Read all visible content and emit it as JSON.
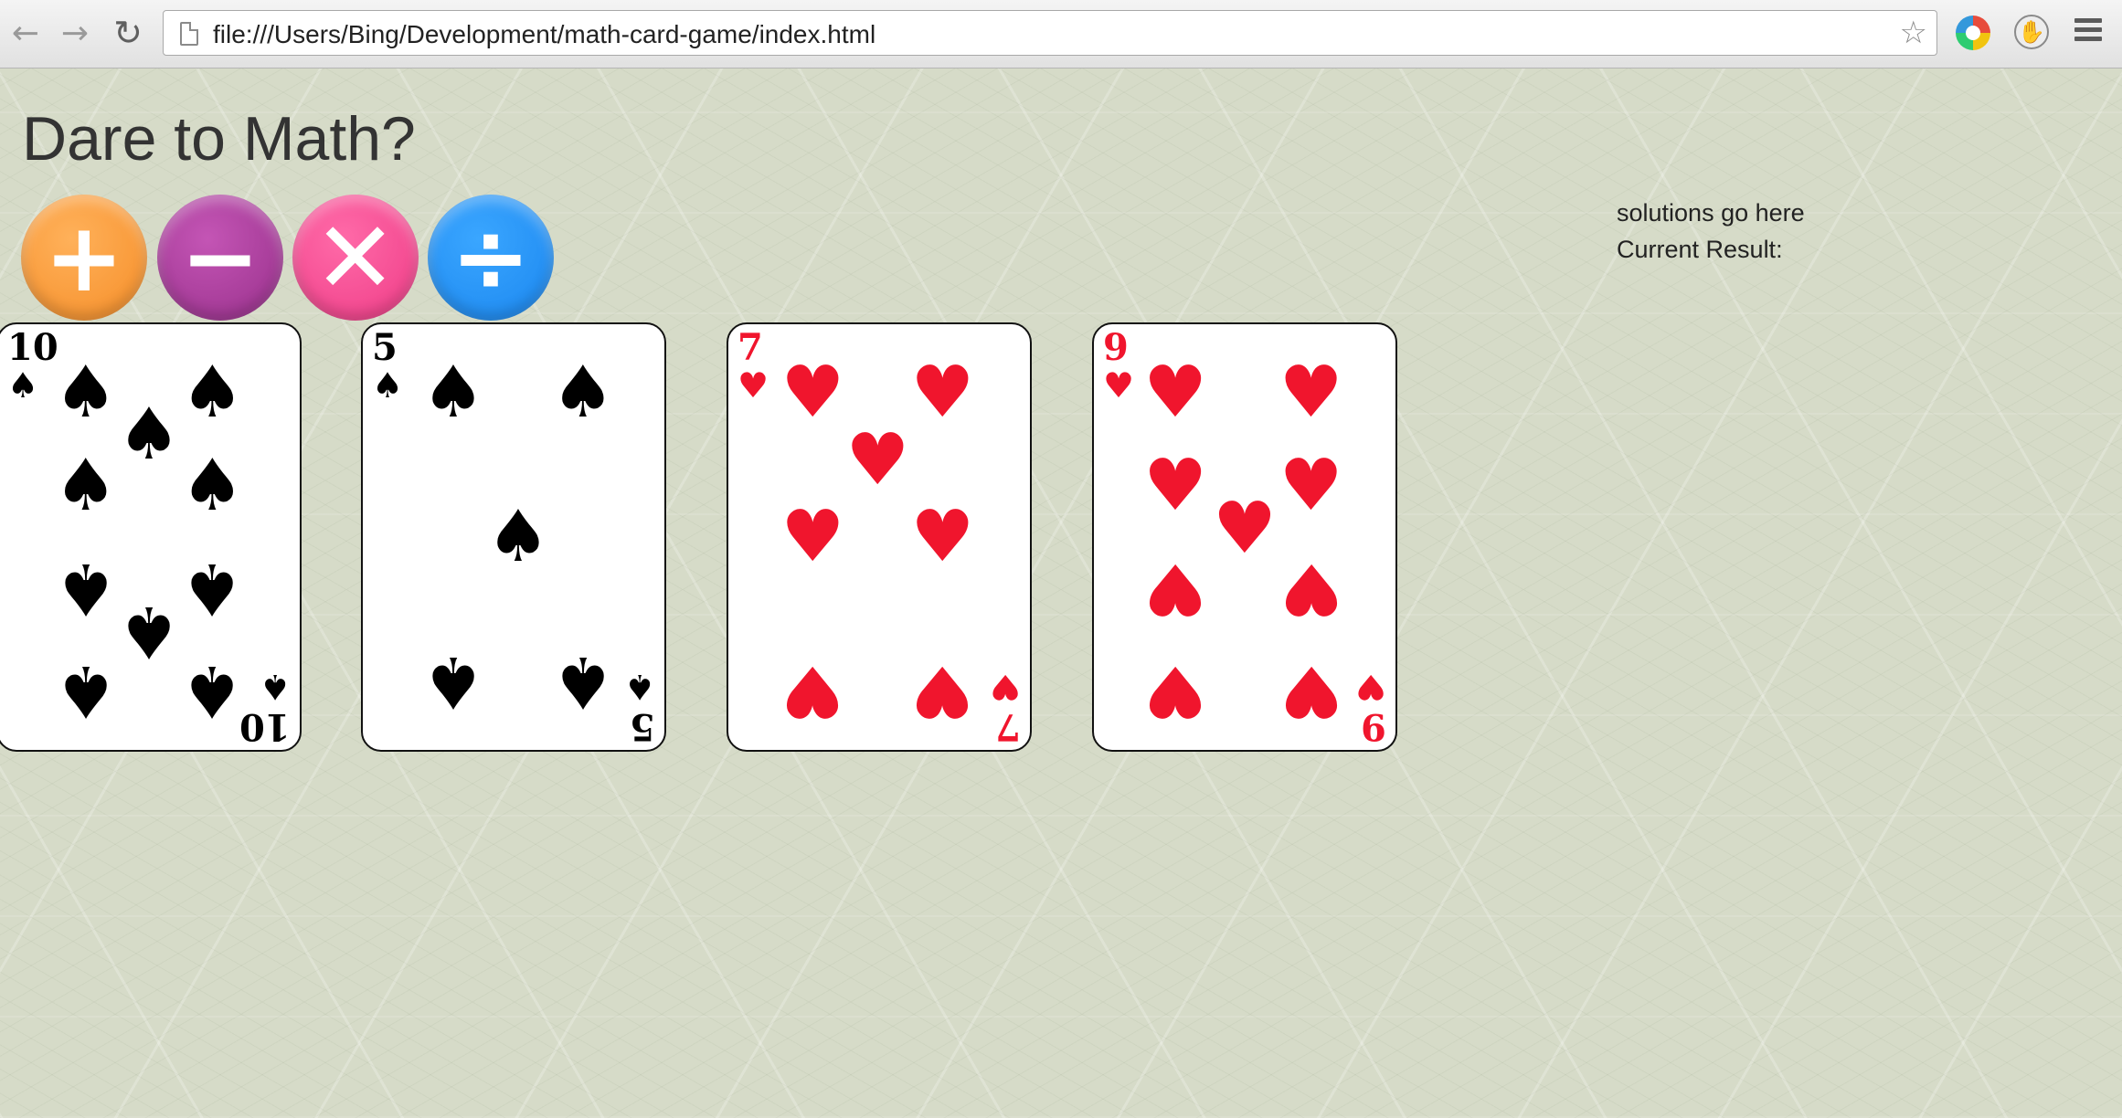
{
  "browser": {
    "url": "file:///Users/Bing/Development/math-card-game/index.html",
    "back_icon": "←",
    "forward_icon": "→",
    "reload_icon": "↻",
    "star_icon": "☆",
    "extension_icon": "✋"
  },
  "page": {
    "title": "Dare to Math?",
    "operators": {
      "add": "+",
      "subtract": "−",
      "multiply": "✕",
      "divide": "÷"
    },
    "solutions_text": "solutions go here",
    "current_result_label": "Current Result:"
  },
  "cards": [
    {
      "rank": "10",
      "suit": "♠",
      "color": "#000000"
    },
    {
      "rank": "5",
      "suit": "♠",
      "color": "#000000"
    },
    {
      "rank": "7",
      "suit": "♥",
      "color": "#f0152d"
    },
    {
      "rank": "9",
      "suit": "♥",
      "color": "#f0152d"
    }
  ]
}
